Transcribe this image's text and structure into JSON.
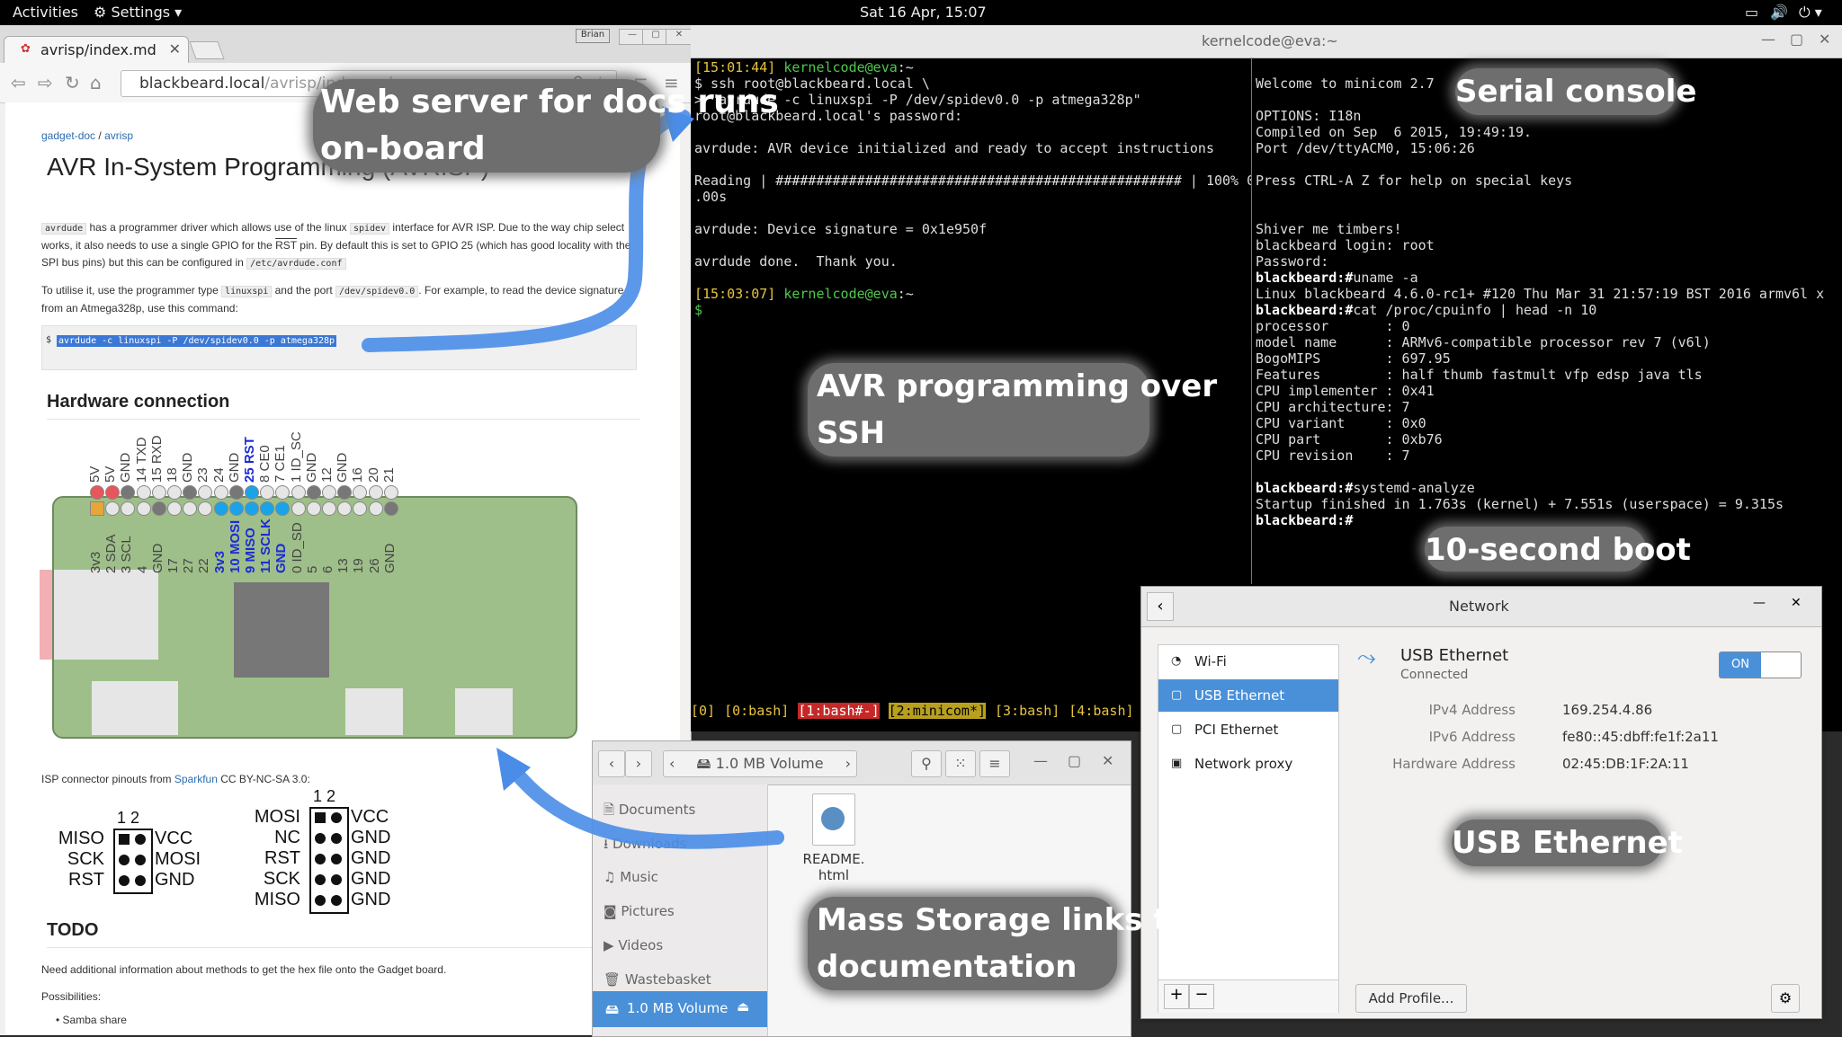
{
  "topbar": {
    "activities": "Activities",
    "settings": "Settings",
    "clock": "Sat 16 Apr, 15:07"
  },
  "browser": {
    "tab_title": "avrisp/index.md",
    "url_host": "blackbeard.local",
    "url_path": "/avrisp/index.md",
    "user_badge": "Brian",
    "breadcrumb_1": "gadget-doc",
    "breadcrumb_sep": "/",
    "breadcrumb_2": "avrisp",
    "title": "AVR In-System Programming (AVRISP)",
    "p1_a": "avrdude",
    "p1_b": " has a programmer driver which allows use of the linux ",
    "p1_c": "spidev",
    "p1_d": " interface for AVR ISP. Due to the way chip select works, it also needs to use a single GPIO for the ",
    "p1_e": "RST",
    "p1_f": " pin. By default this is set to GPIO 25 (which has good locality with the SPI bus pins) but this can be configured in ",
    "p1_g": "/etc/avrdude.conf",
    "p2_a": "To utilise it, use the programmer type ",
    "p2_b": "linuxspi",
    "p2_c": " and the port ",
    "p2_d": "/dev/spidev0.0",
    "p2_e": ". For example, to read the device signature from an Atmega328p, use this command:",
    "cmd_dollar": "$",
    "cmd": "avrdude -c linuxspi -P /dev/spidev0.0 -p atmega328p",
    "h2_hw": "Hardware connection",
    "top_pins": [
      "5V",
      "5V",
      "GND",
      "14 TXD",
      "15 RXD",
      "18",
      "GND",
      "23",
      "24",
      "GND",
      "25 RST",
      "8 CE0",
      "7 CE1",
      "1 ID_SC",
      "GND",
      "12",
      "GND",
      "16",
      "20",
      "21"
    ],
    "bottom_pins": [
      "3v3",
      "2 SDA",
      "3 SCL",
      "4",
      "GND",
      "17",
      "27",
      "22",
      "3v3",
      "10 MOSI",
      "9 MISO",
      "11 SCLK",
      "GND",
      "0 ID_SD",
      "5",
      "6",
      "13",
      "19",
      "26",
      "GND"
    ],
    "isp_caption_a": "ISP connector pinouts from ",
    "isp_caption_link": "Sparkfun",
    "isp_caption_b": " CC BY-NC-SA 3.0:",
    "isp6": {
      "nums": "1 2",
      "left": [
        "MISO",
        "SCK",
        "RST"
      ],
      "right": [
        "VCC",
        "MOSI",
        "GND"
      ]
    },
    "isp10": {
      "nums": "1 2",
      "left": [
        "MOSI",
        "NC",
        "RST",
        "SCK",
        "MISO"
      ],
      "right": [
        "VCC",
        "GND",
        "GND",
        "GND",
        "GND"
      ]
    },
    "h2_todo": "TODO",
    "todo_p": "Need additional information about methods to get the hex file onto the Gadget board.",
    "todo_p2": "Possibilities:",
    "todo_li": "Samba share"
  },
  "terminal": {
    "title": "kernelcode@eva:~",
    "left_lines": [
      {
        "c": "yellow",
        "t": "[15:01:44] ",
        "g": "kernelcode@eva",
        "r": ":~"
      },
      {
        "t": "$ ssh root@blackbeard.local \\"
      },
      {
        "t": "> \"avrdude -c linuxspi -P /dev/spidev0.0 -p atmega328p\""
      },
      {
        "t": "root@blackbeard.local's password:"
      },
      {
        "t": ""
      },
      {
        "t": "avrdude: AVR device initialized and ready to accept instructions"
      },
      {
        "t": ""
      },
      {
        "t": "Reading | ################################################## | 100% 0"
      },
      {
        "t": ".00s"
      },
      {
        "t": ""
      },
      {
        "t": "avrdude: Device signature = 0x1e950f"
      },
      {
        "t": ""
      },
      {
        "t": "avrdude done.  Thank you."
      },
      {
        "t": ""
      },
      {
        "c": "yellow",
        "t": "[15:03:07] ",
        "g": "kernelcode@eva",
        "r": ":~"
      },
      {
        "t": "$"
      }
    ],
    "right_lines": [
      "Welcome to minicom 2.7",
      "",
      "OPTIONS: I18n",
      "Compiled on Sep  6 2015, 19:49:19.",
      "Port /dev/ttyACM0, 15:06:26",
      "",
      "Press CTRL-A Z for help on special keys",
      "",
      "",
      "Shiver me timbers!",
      "blackbeard login: root",
      "Password:",
      "blackbeard:#uname -a",
      "Linux blackbeard 4.6.0-rc1+ #120 Thu Mar 31 21:57:19 BST 2016 armv6l x",
      "blackbeard:#cat /proc/cpuinfo | head -n 10",
      "processor       : 0",
      "model name      : ARMv6-compatible processor rev 7 (v6l)",
      "BogoMIPS        : 697.95",
      "Features        : half thumb fastmult vfp edsp java tls",
      "CPU implementer : 0x41",
      "CPU architecture: 7",
      "CPU variant     : 0x0",
      "CPU part        : 0xb76",
      "CPU revision    : 7",
      "",
      "blackbeard:#systemd-analyze",
      "Startup finished in 1.763s (kernel) + 7.551s (userspace) = 9.315s",
      "blackbeard:#"
    ],
    "tmux": [
      {
        "t": "[0]",
        "s": "plain"
      },
      {
        "t": "[0:bash]",
        "s": "plain"
      },
      {
        "t": "[1:bash#-]",
        "s": "red"
      },
      {
        "t": "[2:minicom*]",
        "s": "amber"
      },
      {
        "t": "[3:bash]",
        "s": "plain"
      },
      {
        "t": "[4:bash]",
        "s": "plain"
      }
    ]
  },
  "files": {
    "path": "1.0 MB Volume",
    "sidebar": [
      "Documents",
      "Downloads",
      "Music",
      "Pictures",
      "Videos",
      "Wastebasket"
    ],
    "selected": "1.0 MB Volume",
    "file_name_1": "README.",
    "file_name_2": "html"
  },
  "network": {
    "title": "Network",
    "items": [
      "Wi-Fi",
      "USB Ethernet",
      "PCI Ethernet",
      "Network proxy"
    ],
    "selected_index": 1,
    "device_name": "USB Ethernet",
    "device_status": "Connected",
    "toggle": "ON",
    "ipv4_label": "IPv4 Address",
    "ipv4": "169.254.4.86",
    "ipv6_label": "IPv6 Address",
    "ipv6": "fe80::45:dbff:fe1f:2a11",
    "hw_label": "Hardware Address",
    "hw": "02:45:DB:1F:2A:11",
    "add_profile": "Add Profile..."
  },
  "callouts": {
    "web1": "Web server for docs runs",
    "web2": "on-board",
    "serial": "Serial console",
    "avr1": "AVR programming over",
    "avr2": "SSH",
    "boot": "10-second boot",
    "usb": "USB Ethernet",
    "mass1": "Mass Storage links to",
    "mass2": "documentation"
  },
  "colors": {
    "accent": "#4a90d9",
    "arrow": "#4a8de8"
  }
}
